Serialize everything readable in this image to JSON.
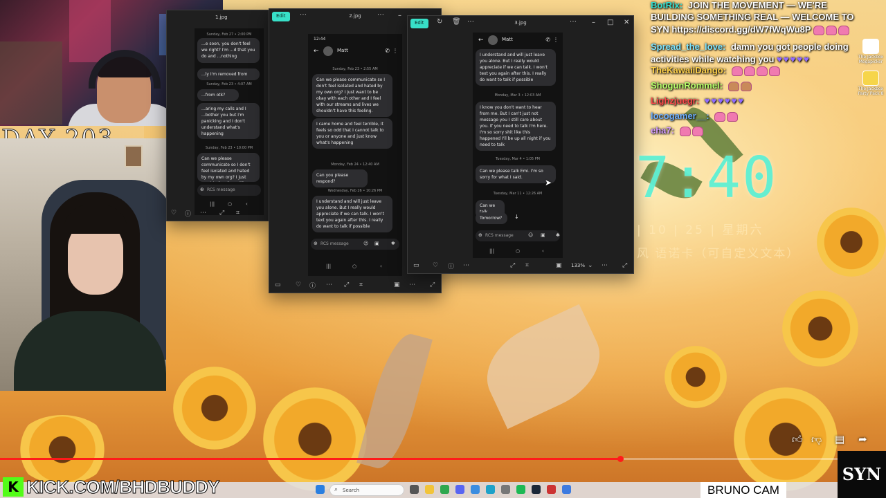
{
  "overlay": {
    "day_banner": "DAY 203",
    "kick_url": "KICK.COM/BHDBUDDY",
    "bruno_cam": "BRUNO CAM",
    "syn_logo": "SYN"
  },
  "chat": [
    {
      "name": "BotRix:",
      "name_color": "#33e0d0",
      "text": "JOIN THE MOVEMENT — WE'RE"
    },
    {
      "name": "",
      "name_color": "#ffffff",
      "text": "BUILDING SOMETHING REAL — WELCOME TO"
    },
    {
      "name": "",
      "name_color": "#ffffff",
      "text": "SYN https://discord.gg/dW7fWqWu8P"
    },
    {
      "name": "Spread_the_love:",
      "name_color": "#7fe6ff",
      "text": "damn you got people doing"
    },
    {
      "name": "",
      "name_color": "#ffffff",
      "text": "activities while watching you"
    },
    {
      "name": "TheKawaiiDango:",
      "name_color": "#ffd24a",
      "text": ""
    },
    {
      "name": "ShogunRommel:",
      "name_color": "#b6ff6a",
      "text": ""
    },
    {
      "name": "Lighzjuegr:",
      "name_color": "#ff4b4b",
      "text": ""
    },
    {
      "name": "locogamer__:",
      "name_color": "#6fb0ff",
      "text": ""
    },
    {
      "name": "eha7:",
      "name_color": "#d7a0ff",
      "text": ""
    }
  ],
  "desktop_icons": [
    {
      "label": "The Jackbox Megapicker"
    },
    {
      "label": "The Jackbox Party Pack 8"
    }
  ],
  "clock": {
    "time": "7:40",
    "date_line": "| 10 | 25 | 星期六",
    "custom_line": "风 语诺卡（可自定义文本）"
  },
  "windows": {
    "win1": {
      "title": "1.jpg",
      "messages": [
        "...e soon, you don't feel we right? I'm ...d that you do and ...nothing",
        "...ly I'm removed from",
        "...from otk?",
        "...aring my calls and I ...bother you but I'm panicking and I don't understand what's happening",
        "Can we please communicate so I don't feel isolated and hated by my own org? I just want to be okay with each other and I ... lh our streams and lives wo shouldn't have"
      ],
      "timestamps": [
        "Sunday, Feb 27 • 2:00 PM",
        "Sunday, Feb 23 • 4:07 AM",
        "Sunday, Feb 23 • 10:00 PM"
      ],
      "composer": "RCS message"
    },
    "win2": {
      "title": "2.jpg",
      "edit_label": "Edit",
      "status_time": "12:44",
      "contact": "Matt",
      "timestamps": [
        "Sunday, Feb 23 • 2:55 AM",
        "Monday, Feb 24 • 12:40 AM",
        "Wednesday, Feb 26 • 10:26 PM"
      ],
      "messages": [
        "Can we please communicate so I don't feel isolated and hated by my own org? I just want to be okay with each other and I feel with our streams and lives we shouldn't have this feeling.",
        "I came home and feel terrible, it feels so odd that I cannot talk to you or anyone and just know what's happening",
        "Can you please respond?",
        "I understand and will just leave you alone. But I really would appreciate if we can talk. I won't text you again after this. I really do want to talk if possible"
      ],
      "composer": "RCS message"
    },
    "win3": {
      "title": "3.jpg",
      "edit_label": "Edit",
      "contact": "Matt",
      "zoom": "133%",
      "timestamps": [
        "Monday, Mar 3 • 12:03 AM",
        "Tuesday, Mar 4 • 1:05 PM",
        "Tuesday, Mar 11 • 12:26 AM"
      ],
      "messages": [
        "I understand and will just leave you alone. But I really would appreciate if we can talk. I won't text you again after this. I really do want to talk if possible",
        "I know you don't want to hear from me. But I can't just not message you I still care about you. If you need to talk I'm here. I'm so sorry shit like this happened I'll be up all night if you need to talk",
        "Can we please talk Emi. I'm so sorry for what I said.",
        "Can we talk",
        "Tomorrow?"
      ],
      "composer": "RCS message"
    }
  },
  "taskbar": {
    "search_placeholder": "Search"
  },
  "player": {
    "progress": 0.7
  },
  "colors": {
    "edit_accent": "#38e0c8",
    "clock": "#5ff0d4",
    "progress": "#ff1a1a",
    "kick_green": "#53fc18"
  }
}
